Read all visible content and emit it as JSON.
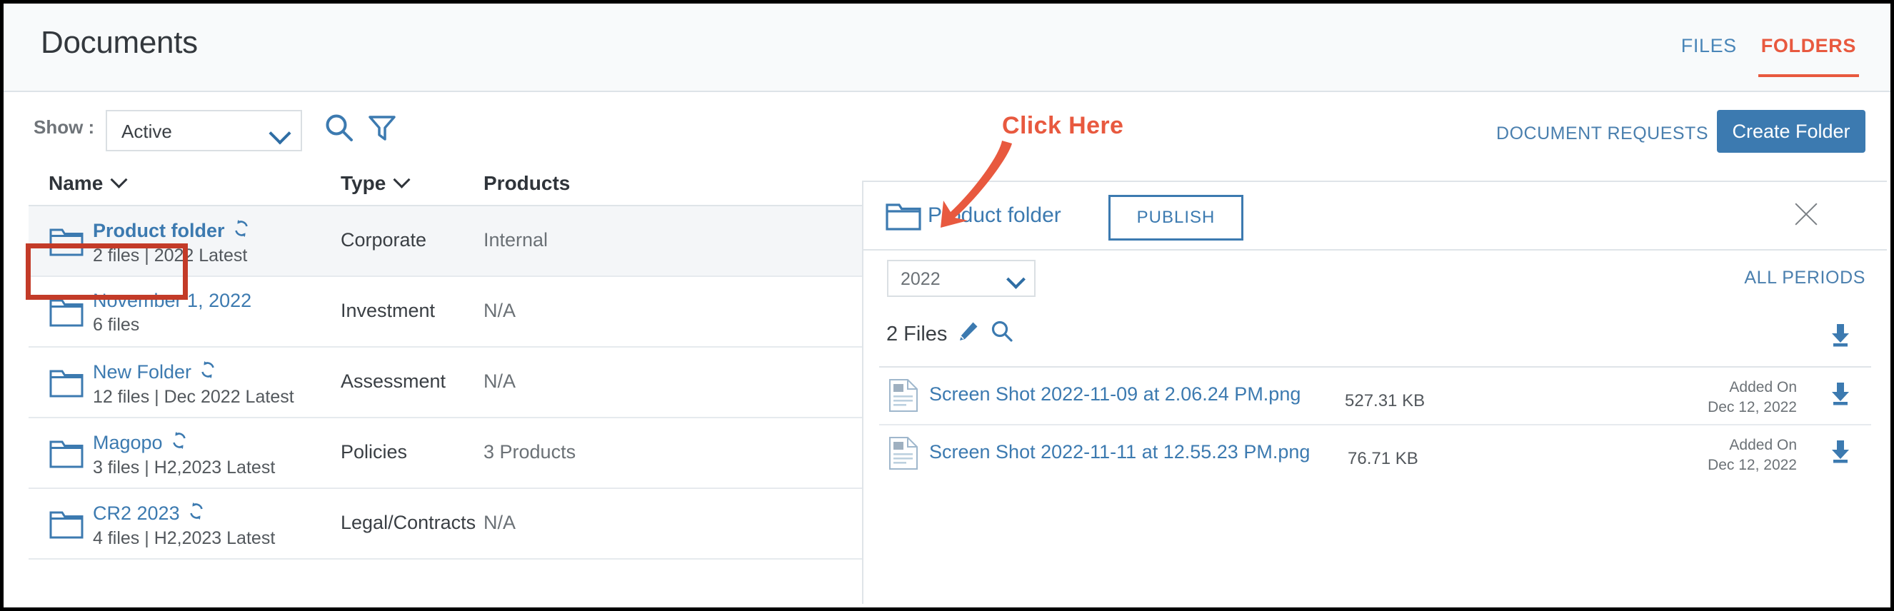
{
  "header": {
    "title": "Documents",
    "tabs": [
      {
        "label": "FILES",
        "active": false
      },
      {
        "label": "FOLDERS",
        "active": true
      }
    ]
  },
  "toolbar": {
    "show_label": "Show :",
    "show_value": "Active",
    "search_icon": "search-icon",
    "filter_icon": "filter-icon",
    "document_requests_label": "DOCUMENT REQUESTS",
    "create_folder_label": "Create Folder"
  },
  "annotation": {
    "text": "Click Here",
    "color": "#e8593f"
  },
  "table": {
    "columns": [
      "Name",
      "Type",
      "Products"
    ],
    "rows": [
      {
        "name": "Product folder",
        "meta": "2 files | 2022 Latest",
        "type": "Corporate",
        "products": "Internal",
        "recurring": true,
        "selected": true
      },
      {
        "name": "November 1, 2022",
        "meta": "6 files",
        "type": "Investment",
        "products": "N/A",
        "recurring": false,
        "selected": false
      },
      {
        "name": "New Folder",
        "meta": "12 files | Dec 2022 Latest",
        "type": "Assessment",
        "products": "N/A",
        "recurring": true,
        "selected": false
      },
      {
        "name": "Magopo",
        "meta": "3 files | H2,2023 Latest",
        "type": "Policies",
        "products": "3 Products",
        "recurring": true,
        "selected": false
      },
      {
        "name": "CR2 2023",
        "meta": "4 files | H2,2023 Latest",
        "type": "Legal/Contracts",
        "products": "N/A",
        "recurring": true,
        "selected": false
      }
    ]
  },
  "panel": {
    "folder_icon": "folder-icon",
    "title": "Product folder",
    "publish_label": "PUBLISH",
    "close_icon": "close-icon",
    "year_value": "2022",
    "all_periods_label": "ALL PERIODS",
    "files_count_label": "2 Files",
    "edit_icon": "pencil-icon",
    "search_icon": "search-icon",
    "download_all_icon": "download-icon",
    "files": [
      {
        "name": "Screen Shot 2022-11-09 at 2.06.24 PM.png",
        "size": "527.31 KB",
        "added_label": "Added On",
        "added_date": "Dec 12, 2022"
      },
      {
        "name": "Screen Shot 2022-11-11 at 12.55.23 PM.png",
        "size": "76.71 KB",
        "added_label": "Added On",
        "added_date": "Dec 12, 2022"
      }
    ]
  },
  "colors": {
    "accent_blue": "#3c7ab0",
    "accent_orange": "#e8593f",
    "highlight_red": "#c33b28",
    "link_blue": "#4a7fae"
  }
}
